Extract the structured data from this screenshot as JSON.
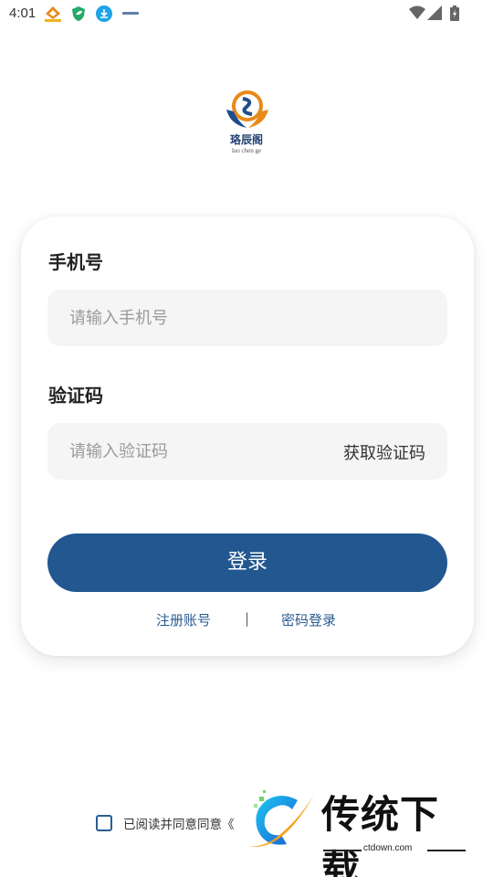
{
  "status_bar": {
    "time": "4:01",
    "notification_icons": [
      "app-badge-icon",
      "shield-leaf-icon",
      "download-icon",
      "small-logo-icon"
    ],
    "system_icons": [
      "wifi-icon",
      "signal-icon",
      "battery-charging-icon"
    ]
  },
  "logo": {
    "name_cn": "珞辰阁",
    "name_en": "luo chen ge"
  },
  "form": {
    "phone_label": "手机号",
    "phone_placeholder": "请输入手机号",
    "code_label": "验证码",
    "code_placeholder": "请输入验证码",
    "get_code_label": "获取验证码",
    "login_label": "登录",
    "register_link": "注册账号",
    "divider": "|",
    "password_login_link": "密码登录"
  },
  "agreement": {
    "text": "已阅读并同意同意《",
    "checked": false
  },
  "watermark": {
    "title": "传统下载",
    "url": "ctdown.com"
  },
  "colors": {
    "primary": "#225790",
    "link": "#2a5c92",
    "input_bg": "#f4f5f4"
  }
}
